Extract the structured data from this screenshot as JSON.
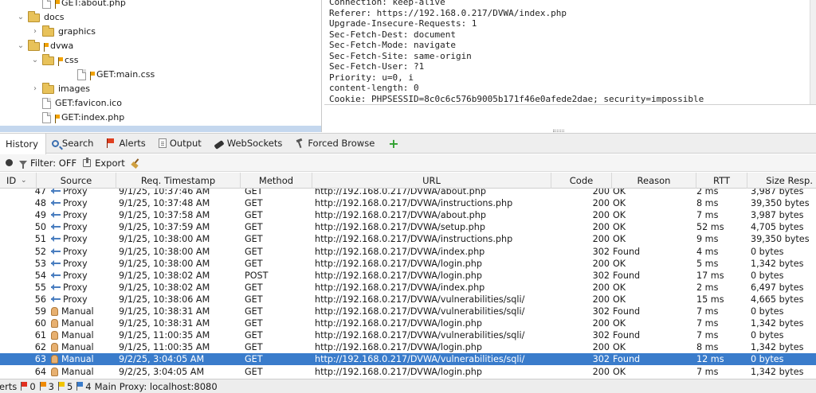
{
  "tree": {
    "rows": [
      {
        "label": "GET:about.php",
        "kind": "file-flag",
        "twisty": ""
      },
      {
        "label": "docs",
        "kind": "folder",
        "twisty": "⌄"
      },
      {
        "label": "graphics",
        "kind": "folder",
        "twisty": "›"
      },
      {
        "label": "dvwa",
        "kind": "folder-flag",
        "twisty": "⌄"
      },
      {
        "label": "css",
        "kind": "folder-flag",
        "twisty": "⌄"
      },
      {
        "label": "GET:main.css",
        "kind": "file-flag",
        "twisty": ""
      },
      {
        "label": "images",
        "kind": "folder",
        "twisty": "›"
      },
      {
        "label": "GET:favicon.ico",
        "kind": "file",
        "twisty": ""
      },
      {
        "label": "GET:index.php",
        "kind": "file-flag",
        "twisty": ""
      }
    ]
  },
  "request_headers": [
    "Connection: keep-alive",
    "Referer: https://192.168.0.217/DVWA/index.php",
    "Upgrade-Insecure-Requests: 1",
    "Sec-Fetch-Dest: document",
    "Sec-Fetch-Mode: navigate",
    "Sec-Fetch-Site: same-origin",
    "Sec-Fetch-User: ?1",
    "Priority: u=0, i",
    "content-length: 0",
    "Cookie: PHPSESSID=8c0c6c576b9005b171f46e0afede2dae; security=impossible"
  ],
  "tabs": {
    "history": "History",
    "search": "Search",
    "alerts": "Alerts",
    "output": "Output",
    "websockets": "WebSockets",
    "forced_browse": "Forced Browse",
    "add": "+"
  },
  "toolbar": {
    "filter": "Filter: OFF",
    "export": "Export"
  },
  "columns": {
    "id": "ID",
    "source": "Source",
    "timestamp": "Req. Timestamp",
    "method": "Method",
    "url": "URL",
    "code": "Code",
    "reason": "Reason",
    "rtt": "RTT",
    "size": "Size Resp."
  },
  "history": [
    {
      "id": "47",
      "source": "Proxy",
      "time": "9/1/25, 10:37:46 AM",
      "method": "GET",
      "url": "http://192.168.0.217/DVWA/about.php",
      "code": "200",
      "reason": "OK",
      "rtt": "2 ms",
      "size": "3,987 bytes"
    },
    {
      "id": "48",
      "source": "Proxy",
      "time": "9/1/25, 10:37:48 AM",
      "method": "GET",
      "url": "http://192.168.0.217/DVWA/instructions.php",
      "code": "200",
      "reason": "OK",
      "rtt": "8 ms",
      "size": "39,350 bytes"
    },
    {
      "id": "49",
      "source": "Proxy",
      "time": "9/1/25, 10:37:58 AM",
      "method": "GET",
      "url": "http://192.168.0.217/DVWA/about.php",
      "code": "200",
      "reason": "OK",
      "rtt": "7 ms",
      "size": "3,987 bytes"
    },
    {
      "id": "50",
      "source": "Proxy",
      "time": "9/1/25, 10:37:59 AM",
      "method": "GET",
      "url": "http://192.168.0.217/DVWA/setup.php",
      "code": "200",
      "reason": "OK",
      "rtt": "52 ms",
      "size": "4,705 bytes"
    },
    {
      "id": "51",
      "source": "Proxy",
      "time": "9/1/25, 10:38:00 AM",
      "method": "GET",
      "url": "http://192.168.0.217/DVWA/instructions.php",
      "code": "200",
      "reason": "OK",
      "rtt": "9 ms",
      "size": "39,350 bytes"
    },
    {
      "id": "52",
      "source": "Proxy",
      "time": "9/1/25, 10:38:00 AM",
      "method": "GET",
      "url": "http://192.168.0.217/DVWA/index.php",
      "code": "302",
      "reason": "Found",
      "rtt": "4 ms",
      "size": "0 bytes"
    },
    {
      "id": "53",
      "source": "Proxy",
      "time": "9/1/25, 10:38:00 AM",
      "method": "GET",
      "url": "http://192.168.0.217/DVWA/login.php",
      "code": "200",
      "reason": "OK",
      "rtt": "5 ms",
      "size": "1,342 bytes"
    },
    {
      "id": "54",
      "source": "Proxy",
      "time": "9/1/25, 10:38:02 AM",
      "method": "POST",
      "url": "http://192.168.0.217/DVWA/login.php",
      "code": "302",
      "reason": "Found",
      "rtt": "17 ms",
      "size": "0 bytes"
    },
    {
      "id": "55",
      "source": "Proxy",
      "time": "9/1/25, 10:38:02 AM",
      "method": "GET",
      "url": "http://192.168.0.217/DVWA/index.php",
      "code": "200",
      "reason": "OK",
      "rtt": "2 ms",
      "size": "6,497 bytes"
    },
    {
      "id": "56",
      "source": "Proxy",
      "time": "9/1/25, 10:38:06 AM",
      "method": "GET",
      "url": "http://192.168.0.217/DVWA/vulnerabilities/sqli/",
      "code": "200",
      "reason": "OK",
      "rtt": "15 ms",
      "size": "4,665 bytes"
    },
    {
      "id": "59",
      "source": "Manual",
      "time": "9/1/25, 10:38:31 AM",
      "method": "GET",
      "url": "http://192.168.0.217/DVWA/vulnerabilities/sqli/",
      "code": "302",
      "reason": "Found",
      "rtt": "7 ms",
      "size": "0 bytes"
    },
    {
      "id": "60",
      "source": "Manual",
      "time": "9/1/25, 10:38:31 AM",
      "method": "GET",
      "url": "http://192.168.0.217/DVWA/login.php",
      "code": "200",
      "reason": "OK",
      "rtt": "7 ms",
      "size": "1,342 bytes"
    },
    {
      "id": "61",
      "source": "Manual",
      "time": "9/1/25, 11:00:35 AM",
      "method": "GET",
      "url": "http://192.168.0.217/DVWA/vulnerabilities/sqli/",
      "code": "302",
      "reason": "Found",
      "rtt": "7 ms",
      "size": "0 bytes"
    },
    {
      "id": "62",
      "source": "Manual",
      "time": "9/1/25, 11:00:35 AM",
      "method": "GET",
      "url": "http://192.168.0.217/DVWA/login.php",
      "code": "200",
      "reason": "OK",
      "rtt": "8 ms",
      "size": "1,342 bytes"
    },
    {
      "id": "63",
      "source": "Manual",
      "time": "9/2/25, 3:04:05 AM",
      "method": "GET",
      "url": "http://192.168.0.217/DVWA/vulnerabilities/sqli/",
      "code": "302",
      "reason": "Found",
      "rtt": "12 ms",
      "size": "0 bytes",
      "selected": true
    },
    {
      "id": "64",
      "source": "Manual",
      "time": "9/2/25, 3:04:05 AM",
      "method": "GET",
      "url": "http://192.168.0.217/DVWA/login.php",
      "code": "200",
      "reason": "OK",
      "rtt": "7 ms",
      "size": "1,342 bytes"
    }
  ],
  "status": {
    "alerts_label": "erts",
    "high": "0",
    "medium": "3",
    "low": "5",
    "info": "4",
    "proxy": "Main Proxy: localhost:8080"
  },
  "colors": {
    "selection": "#3a7ccb",
    "flag_high": "#e03020",
    "flag_medium": "#f08a00",
    "flag_low": "#f2c500",
    "flag_info": "#3a7ccb"
  }
}
